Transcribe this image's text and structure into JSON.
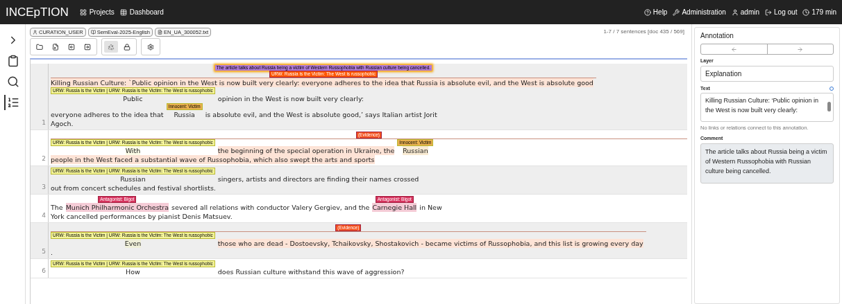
{
  "navbar": {
    "brand": "INCEpTION",
    "links": [
      "Projects",
      "Dashboard"
    ],
    "right": [
      "Help",
      "Administration",
      "admin",
      "Log out",
      "179 min"
    ]
  },
  "sidebar": [
    {
      "selected": false
    },
    {
      "selected": false
    },
    {
      "selected": false
    },
    {
      "selected": true
    }
  ],
  "breadcrumbs": [
    "CURATION_USER",
    "SemEval-2025-English",
    "EN_UA_300052.txt"
  ],
  "toolbar_groups": [
    [
      {
        "disabled": false
      },
      {
        "disabled": false
      },
      {
        "disabled": false
      },
      {
        "disabled": false
      }
    ],
    [
      {
        "disabled": true
      },
      {
        "disabled": false
      }
    ],
    [
      {
        "disabled": false
      }
    ]
  ],
  "sentence_count": "1-7 / 7 sentences [doc 435 / 569]",
  "sentences": [
    {
      "number": "1",
      "lines": [
        {
          "comment": "The article talks about Russia being a victim of Western Russophobia with Russian culture being cancelled.",
          "span_label": {
            "text": "URW: Russia is the Victim: The West is russophobic",
            "color": "#ff5500"
          },
          "segments": [
            {
              "text": "Killing Russian Culture: `Public opinion in the West is now built very clearly: everyone adheres to the idea that Russia is absolute evil, and the West is absolute good",
              "highlighted": true
            }
          ]
        },
        {
          "segments": [
            {
              "text": "Public",
              "highlighted": false,
              "label": {
                "text": "URW: Russia is the Victim | URW: Russia is the Victim: The West is russophobic",
                "color": "#f5f59a"
              }
            },
            {
              "text": "opinion in the West is now built very clearly:",
              "highlighted": false
            }
          ]
        },
        {
          "segments": [
            {
              "text": "everyone adheres to the idea that",
              "highlighted": false
            },
            {
              "text": "Russia",
              "highlighted": false,
              "label": {
                "text": "Innocent: Victim",
                "color": "#e8b04e"
              }
            },
            {
              "text": "is absolute evil, and the West is absolute good,’ says Italian artist Jorit",
              "highlighted": false
            }
          ]
        },
        {
          "segments": [
            {
              "text": "Agoch.",
              "highlighted": false
            }
          ]
        }
      ]
    },
    {
      "number": "2",
      "lines": [
        {
          "span_label": {
            "text": "(Evidence)",
            "color": "#f4511e"
          },
          "segments": [
            {
              "text": "With",
              "highlighted": true,
              "label": {
                "text": "URW: Russia is the Victim | URW: Russia is the Victim: The West is russophobic",
                "color": "#f5f59a"
              }
            },
            {
              "text": "the beginning of the special operation in Ukraine, the",
              "highlighted": true
            },
            {
              "text": "Russian",
              "highlighted": true,
              "label": {
                "text": "Innocent: Victim",
                "color": "#e8b04e"
              }
            },
            {
              "text": "people in the West faced a substantial wave of Russophobia, which also swept the arts and sports",
              "highlighted": true
            }
          ]
        }
      ]
    },
    {
      "number": "3",
      "lines": [
        {
          "segments": [
            {
              "text": "Russian",
              "highlighted": false,
              "label": {
                "text": "URW: Russia is the Victim | URW: Russia is the Victim: The West is russophobic",
                "color": "#f5f59a"
              }
            },
            {
              "text": "singers, artists and directors are finding their names crossed",
              "highlighted": false
            }
          ]
        },
        {
          "segments": [
            {
              "text": "out from concert schedules and festival shortlists.",
              "highlighted": false
            }
          ]
        }
      ]
    },
    {
      "number": "4",
      "lines": [
        {
          "segments": [
            {
              "text": "The",
              "highlighted": false
            },
            {
              "text": "Munich Philharmonic Orchestra",
              "highlighted": true,
              "label": {
                "text": "Antagonist: Bigot",
                "color": "#d6335e"
              }
            },
            {
              "text": "severed all relations with conductor Valery Gergiev, and the",
              "highlighted": false
            },
            {
              "text": "Carnegie Hall",
              "highlighted": true,
              "label": {
                "text": "Antagonist: Bigot",
                "color": "#d6335e"
              }
            },
            {
              "text": "in New",
              "highlighted": false
            }
          ]
        },
        {
          "segments": [
            {
              "text": "York cancelled performances by pianist Denis Matsuev.",
              "highlighted": false
            }
          ]
        }
      ]
    },
    {
      "number": "5",
      "lines": [
        {
          "span_label": {
            "text": "(Evidence)",
            "color": "#f4511e"
          },
          "segments": [
            {
              "text": "Even",
              "highlighted": true,
              "label": {
                "text": "URW: Russia is the Victim | URW: Russia is the Victim: The West is russophobic",
                "color": "#f5f59a"
              }
            },
            {
              "text": "those who are dead - Dostoevsky, Tchaikovsky, Shostakovich - became victims of Russophobia, and this list is growing every day",
              "highlighted": true
            }
          ]
        },
        {
          "segments": [
            {
              "text": ".",
              "highlighted": false
            }
          ]
        }
      ]
    },
    {
      "number": "6",
      "lines": [
        {
          "segments": [
            {
              "text": "How",
              "highlighted": false,
              "label": {
                "text": "URW: Russia is the Victim | URW: Russia is the Victim: The West is russophobic",
                "color": "#f5f59a"
              }
            },
            {
              "text": "does Russian culture withstand this wave of aggression?",
              "highlighted": false
            }
          ]
        }
      ]
    }
  ],
  "annotation_panel": {
    "title": "Annotation",
    "layer_label": "Layer",
    "layer_value": "Explanation",
    "text_label": "Text",
    "text_value": "Killing Russian Culture: ‘Public opinion in the West is now built very clearly:",
    "no_links": "No links or relations connect to this annotation.",
    "comment_label": "Comment",
    "comment_value": "The article talks about Russia being a victim of Western Russophobia with Russian culture being cancelled."
  }
}
